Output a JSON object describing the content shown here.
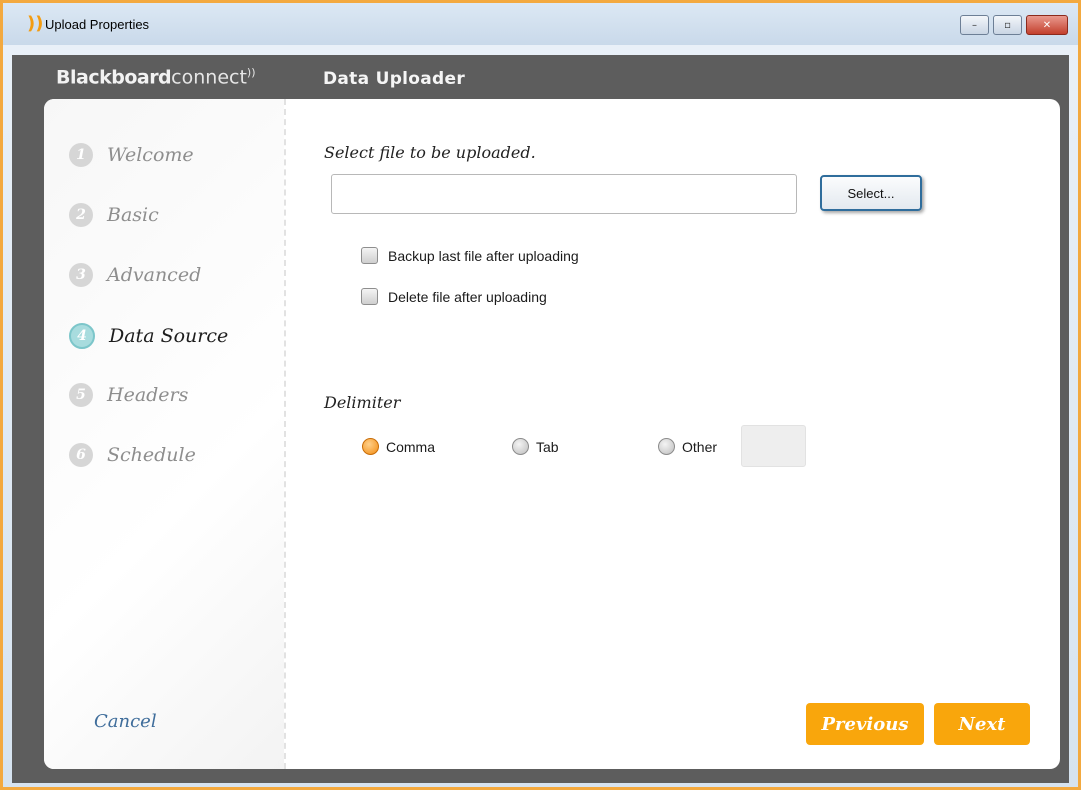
{
  "window": {
    "title": "Upload Properties",
    "logo_glyph": "))",
    "minimize_glyph": "–",
    "maximize_glyph": "▫",
    "close_glyph": "✕"
  },
  "app": {
    "brand_bold": "Blackboard",
    "brand_light": "connect",
    "brand_mark": "))",
    "title": "Data Uploader"
  },
  "steps": [
    {
      "num": "1",
      "label": "Welcome"
    },
    {
      "num": "2",
      "label": "Basic"
    },
    {
      "num": "3",
      "label": "Advanced"
    },
    {
      "num": "4",
      "label": "Data Source"
    },
    {
      "num": "5",
      "label": "Headers"
    },
    {
      "num": "6",
      "label": "Schedule"
    }
  ],
  "active_step": "4",
  "cancel_label": "Cancel",
  "file": {
    "heading": "Select file to be uploaded.",
    "path_value": "",
    "select_label": "Select...",
    "backup_label": "Backup last file after uploading",
    "backup_checked": false,
    "delete_label": "Delete file after uploading",
    "delete_checked": false
  },
  "delimiter": {
    "heading": "Delimiter",
    "options": [
      "Comma",
      "Tab",
      "Other"
    ],
    "selected": "Comma",
    "other_value": ""
  },
  "nav": {
    "previous_label": "Previous",
    "next_label": "Next"
  },
  "colors": {
    "accent": "#f9a60c",
    "active_step": "#a8dcde",
    "header_bg": "#5d5d5d",
    "window_border": "#f3a93f"
  }
}
